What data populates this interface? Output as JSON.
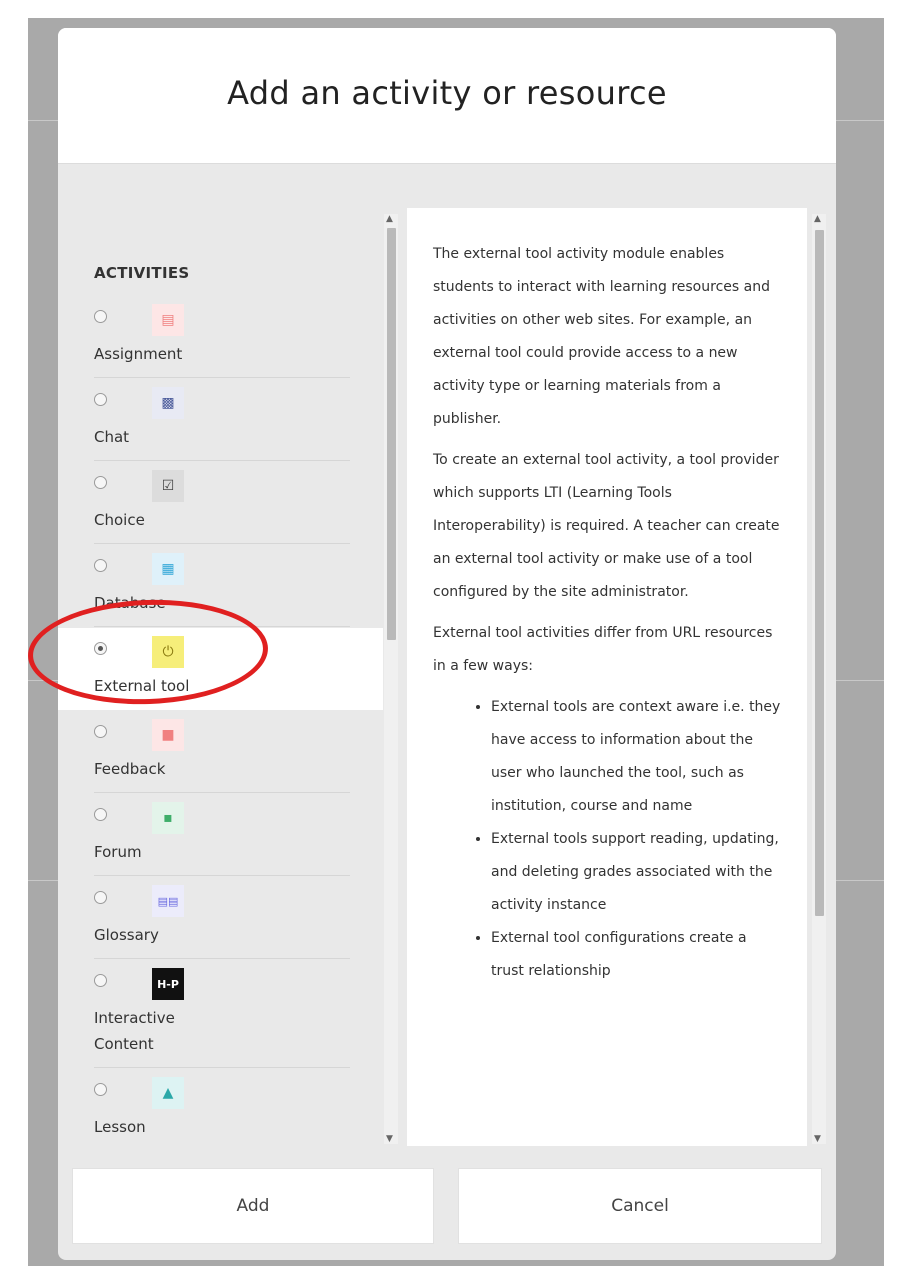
{
  "dialog": {
    "title": "Add an activity or resource",
    "section_heading": "ACTIVITIES",
    "activities": [
      {
        "label": "Assignment",
        "icon": "assignment-icon",
        "icon_color": "#f08080",
        "selected": false
      },
      {
        "label": "Chat",
        "icon": "chat-icon",
        "icon_color": "#4a5a9a",
        "selected": false
      },
      {
        "label": "Choice",
        "icon": "choice-icon",
        "icon_color": "#444444",
        "selected": false
      },
      {
        "label": "Database",
        "icon": "database-icon",
        "icon_color": "#35a8d8",
        "selected": false
      },
      {
        "label": "External tool",
        "icon": "plug-icon",
        "icon_color": "#f2e24a",
        "selected": true
      },
      {
        "label": "Feedback",
        "icon": "feedback-icon",
        "icon_color": "#f08080",
        "selected": false
      },
      {
        "label": "Forum",
        "icon": "forum-icon",
        "icon_color": "#3fae6a",
        "selected": false
      },
      {
        "label": "Glossary",
        "icon": "glossary-icon",
        "icon_color": "#6a6ae0",
        "selected": false
      },
      {
        "label": "Interactive\nContent",
        "icon": "h5p-icon",
        "icon_color": "#111111",
        "selected": false
      },
      {
        "label": "Lesson",
        "icon": "lesson-icon",
        "icon_color": "#2aa8a8",
        "selected": false
      }
    ],
    "description": {
      "paragraphs": [
        "The external tool activity module enables students to interact with learning resources and activities on other web sites. For example, an external tool could provide access to a new activity type or learning materials from a publisher.",
        "To create an external tool activity, a tool provider which supports LTI (Learning Tools Interoperability) is required. A teacher can create an external tool activity or make use of a tool configured by the site administrator.",
        "External tool activities differ from URL resources in a few ways:"
      ],
      "bullets": [
        "External tools are context aware i.e. they have access to information about the user who launched the tool, such as institution, course and name",
        "External tools support reading, updating, and deleting grades associated with the activity instance",
        "External tool configurations create a trust relationship"
      ]
    },
    "buttons": {
      "add": "Add",
      "cancel": "Cancel"
    },
    "h5p_icon_text": "H-P"
  },
  "colors": {
    "highlight": "#e02020",
    "selected_bg": "#ffffff"
  }
}
